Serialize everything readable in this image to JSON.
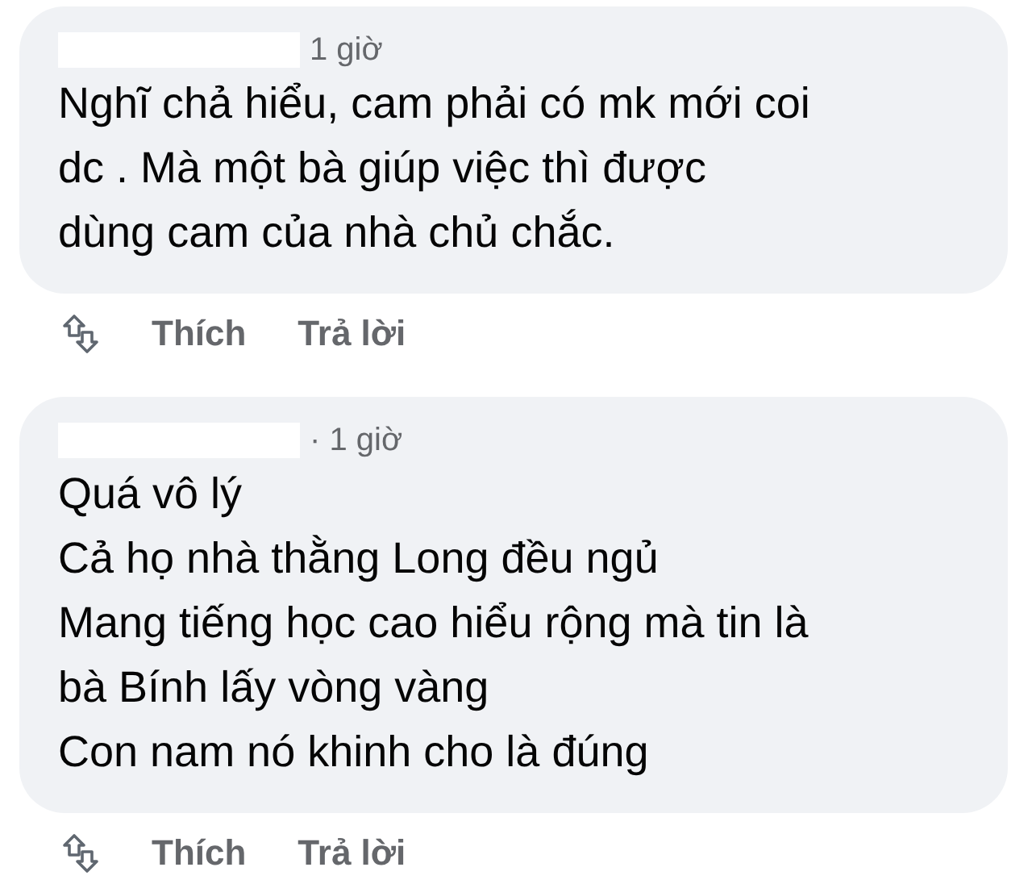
{
  "comments": [
    {
      "time": "1 giờ",
      "lines": [
        "Nghĩ chả hiểu, cam phải có mk mới coi",
        "dc . Mà một bà giúp việc thì được",
        "dùng cam của nhà chủ chắc."
      ],
      "actions": [
        "Thích",
        "Trả lời"
      ]
    },
    {
      "time": "· 1 giờ",
      "lines": [
        "Quá vô lý",
        "Cả họ nhà thằng Long đều ngủ",
        "Mang tiếng học cao hiểu rộng mà tin là",
        "bà Bính lấy vòng vàng",
        "Con nam nó khinh cho là đúng"
      ],
      "actions": [
        "Thích",
        "Trả lời"
      ]
    }
  ]
}
